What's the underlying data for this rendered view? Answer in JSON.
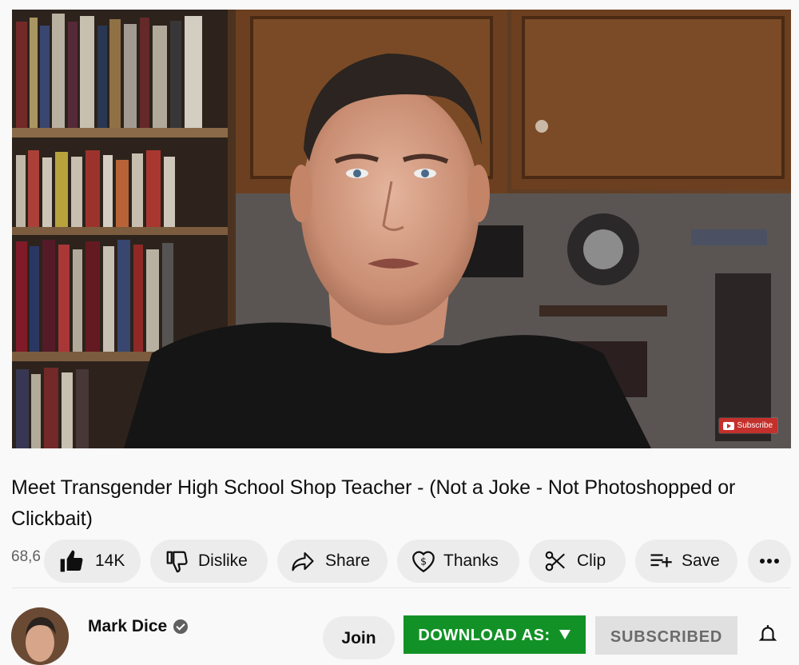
{
  "video": {
    "overlay_subscribe_label": "Subscribe",
    "title": "Meet Transgender High School Shop Teacher - (Not a Joke - Not Photoshopped or Clickbait)"
  },
  "actions": {
    "views_partial": "68,6",
    "like_count": "14K",
    "dislike_label": "Dislike",
    "share_label": "Share",
    "thanks_label": "Thanks",
    "clip_label": "Clip",
    "save_label": "Save"
  },
  "channel": {
    "name": "Mark Dice",
    "join_label": "Join",
    "download_label": "DOWNLOAD AS:",
    "subscribed_label": "SUBSCRIBED"
  },
  "colors": {
    "download_green": "#129226",
    "subscribe_red": "#c4302b",
    "pill_bg": "#ececec"
  },
  "icons": [
    "like-icon",
    "dislike-icon",
    "share-icon",
    "thanks-icon",
    "clip-icon",
    "save-icon",
    "more-icon",
    "verified-icon",
    "bell-icon",
    "dropdown-arrow-icon"
  ]
}
